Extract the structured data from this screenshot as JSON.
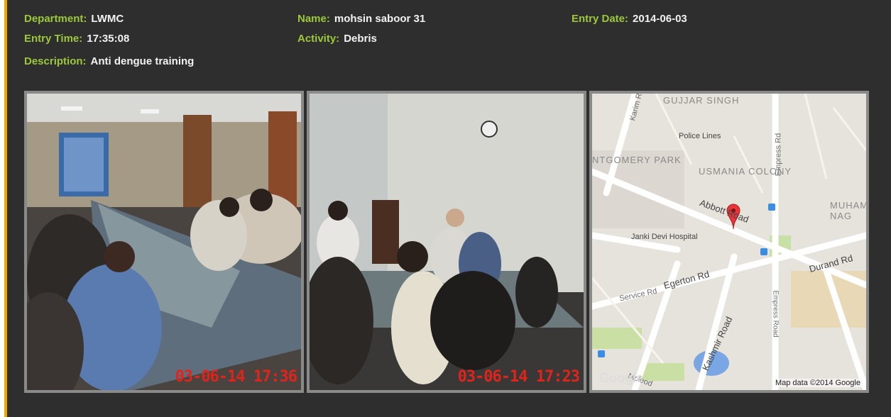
{
  "record": {
    "department": {
      "label": "Department:",
      "value": "LWMC"
    },
    "name": {
      "label": "Name:",
      "value": "mohsin saboor 31"
    },
    "entry_date": {
      "label": "Entry Date:",
      "value": "2014-06-03"
    },
    "entry_time": {
      "label": "Entry Time:",
      "value": "17:35:08"
    },
    "activity": {
      "label": "Activity:",
      "value": "Debris"
    },
    "description": {
      "label": "Description:",
      "value": "Anti dengue training"
    }
  },
  "photos": [
    {
      "timestamp": "03-06-14 17:36"
    },
    {
      "timestamp": "03-06-14 17:23"
    }
  ],
  "map": {
    "labels": {
      "gujjar_singh": "GUJJAR SINGH",
      "karim_rd": "Karim Rd",
      "police_lines": "Police Lines",
      "montgomery_park": "NTGOMERY PARK",
      "usmania_colony": "USMANIA COLONY",
      "empress_rd": "Empress Rd",
      "abbott_road": "Abbott Road",
      "janki_devi": "Janki Devi Hospital",
      "egerton_rd": "Egerton Rd",
      "service_rd": "Service Rd",
      "durand_rd": "Durand Rd",
      "kashmir_road": "Kashmir Road",
      "empress_road": "Empress Road",
      "muham_nag": "MUHAM NAG",
      "mcleod": "Mcleod"
    },
    "logo": "Google",
    "credit": "Map data ©2014 Google"
  }
}
